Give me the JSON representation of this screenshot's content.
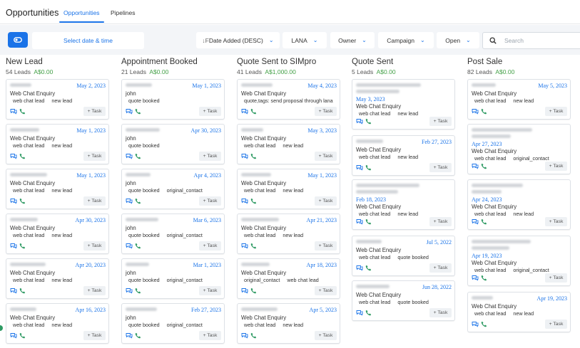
{
  "header": {
    "title": "Opportunities",
    "tabs": [
      {
        "label": "Opportunities",
        "active": true
      },
      {
        "label": "Pipelines",
        "active": false
      }
    ]
  },
  "filters": {
    "date_picker_label": "Select date & time",
    "sort_label": "Date Added (DESC)",
    "pipeline_label": "LANA",
    "owner_label": "Owner",
    "campaign_label": "Campaign",
    "status_label": "Open",
    "search_placeholder": "Search"
  },
  "task_label": "+ Task",
  "columns": [
    {
      "name": "New Lead",
      "leads": "54 Leads",
      "amount": "A$0.00",
      "cards": [
        {
          "date": "May 2, 2023",
          "title": "Web Chat Enquiry",
          "tags": [
            "web chat lead",
            "new lead"
          ]
        },
        {
          "date": "May 1, 2023",
          "title": "Web Chat Enquiry",
          "tags": [
            "web chat lead",
            "new lead"
          ]
        },
        {
          "date": "May 1, 2023",
          "title": "Web Chat Enquiry",
          "tags": [
            "web chat lead",
            "new lead"
          ]
        },
        {
          "date": "Apr 30, 2023",
          "title": "Web Chat Enquiry",
          "tags": [
            "web chat lead",
            "new lead"
          ]
        },
        {
          "date": "Apr 20, 2023",
          "title": "Web Chat Enquiry",
          "tags": [
            "web chat lead",
            "new lead"
          ]
        },
        {
          "date": "Apr 16, 2023",
          "title": "Web Chat Enquiry",
          "tags": [
            "web chat lead",
            "new lead"
          ]
        }
      ]
    },
    {
      "name": "Appointment Booked",
      "leads": "21 Leads",
      "amount": "A$0.00",
      "cards": [
        {
          "date": "May 1, 2023",
          "title": "john",
          "tags": [
            "quote booked"
          ]
        },
        {
          "date": "Apr 30, 2023",
          "title": "john",
          "tags": [
            "quote booked"
          ]
        },
        {
          "date": "Apr 4, 2023",
          "title": "john",
          "tags": [
            "quote booked",
            "original_contact"
          ]
        },
        {
          "date": "Mar 6, 2023",
          "title": "john",
          "tags": [
            "quote booked",
            "original_contact"
          ]
        },
        {
          "date": "Mar 1, 2023",
          "title": "john",
          "tags": [
            "quote booked",
            "original_contact"
          ]
        },
        {
          "date": "Feb 27, 2023",
          "title": "john",
          "tags": [
            "quote booked",
            "original_contact"
          ]
        }
      ]
    },
    {
      "name": "Quote Sent to SIMpro",
      "leads": "41 Leads",
      "amount": "A$1,000.00",
      "cards": [
        {
          "date": "May 4, 2023",
          "title": "Web Chat Enquiry",
          "tags": [
            "quote,tags: send proposal through lana"
          ]
        },
        {
          "date": "May 3, 2023",
          "title": "Web Chat Enquiry",
          "tags": [
            "web chat lead",
            "new lead"
          ]
        },
        {
          "date": "May 1, 2023",
          "title": "Web Chat Enquiry",
          "tags": [
            "web chat lead",
            "new lead"
          ]
        },
        {
          "date": "Apr 21, 2023",
          "title": "Web Chat Enquiry",
          "tags": [
            "web chat lead",
            "new lead"
          ]
        },
        {
          "date": "Apr 18, 2023",
          "title": "Web Chat Enquiry",
          "tags": [
            "original_contact",
            "web chat lead"
          ]
        },
        {
          "date": "Apr 5, 2023",
          "title": "Web Chat Enquiry",
          "tags": [
            "web chat lead",
            "new lead"
          ]
        }
      ]
    },
    {
      "name": "Quote Sent",
      "leads": "5 Leads",
      "amount": "A$0.00",
      "cards": [
        {
          "date": "May 3, 2023",
          "title": "Web Chat Enquiry",
          "tags": [
            "web chat lead",
            "new lead"
          ]
        },
        {
          "date": "Feb 27, 2023",
          "title": "Web Chat Enquiry",
          "tags": [
            "web chat lead",
            "new lead"
          ]
        },
        {
          "date": "Feb 18, 2023",
          "title": "Web Chat Enquiry",
          "tags": [
            "web chat lead",
            "new lead"
          ]
        },
        {
          "date": "Jul 5, 2022",
          "title": "Web Chat Enquiry",
          "tags": [
            "web chat lead",
            "quote booked"
          ]
        },
        {
          "date": "Jun 28, 2022",
          "title": "Web Chat Enquiry",
          "tags": [
            "web chat lead",
            "quote booked"
          ]
        }
      ]
    },
    {
      "name": "Post Sale",
      "leads": "82 Leads",
      "amount": "A$0.00",
      "cards": [
        {
          "date": "May 5, 2023",
          "title": "Web Chat Enquiry",
          "tags": [
            "web chat lead",
            "new lead"
          ]
        },
        {
          "date": "Apr 27, 2023",
          "title": "Web Chat Enquiry",
          "tags": [
            "web chat lead",
            "original_contact"
          ]
        },
        {
          "date": "Apr 24, 2023",
          "title": "Web Chat Enquiry",
          "tags": [
            "web chat lead",
            "new lead"
          ]
        },
        {
          "date": "Apr 19, 2023",
          "title": "Web Chat Enquiry",
          "tags": [
            "web chat lead",
            "original_contact"
          ]
        },
        {
          "date": "Apr 19, 2023",
          "title": "Web Chat Enquiry",
          "tags": [
            "web chat lead",
            "new lead"
          ]
        }
      ]
    }
  ],
  "colors": {
    "accent": "#1a73e8",
    "amount": "#43a047",
    "phone": "#2e9a63"
  }
}
